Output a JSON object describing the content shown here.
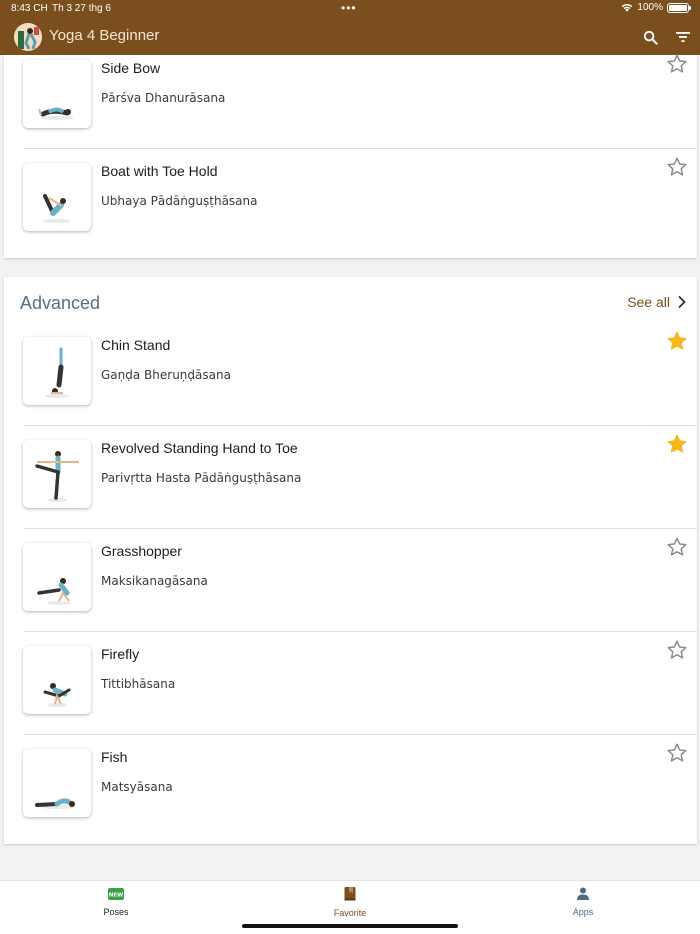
{
  "status": {
    "time": "8:43 CH",
    "date": "Th 3 27 thg 6",
    "battery": "100%"
  },
  "app": {
    "title": "Yoga 4 Beginner"
  },
  "top_section": {
    "poses": [
      {
        "name": "Side Bow",
        "sanskrit": "Pārśva Dhanurāsana",
        "favorite": false
      },
      {
        "name": "Boat with Toe Hold",
        "sanskrit": "Ubhaya Pādāṅguṣṭhāsana",
        "favorite": false
      }
    ]
  },
  "advanced": {
    "title": "Advanced",
    "see_all": "See all",
    "poses": [
      {
        "name": "Chin Stand",
        "sanskrit": "Gaṇḍa Bheruṇḍāsana",
        "favorite": true
      },
      {
        "name": "Revolved Standing Hand to Toe",
        "sanskrit": "Parivṛtta Hasta Pādāṅguṣṭhāsana",
        "favorite": true
      },
      {
        "name": "Grasshopper",
        "sanskrit": "Maksikanagāsana",
        "favorite": false
      },
      {
        "name": "Firefly",
        "sanskrit": "Tittibhāsana",
        "favorite": false
      },
      {
        "name": "Fish",
        "sanskrit": "Matsyāsana",
        "favorite": false
      }
    ]
  },
  "tabs": {
    "poses": {
      "label": "Poses",
      "badge": "NEW"
    },
    "favorite": {
      "label": "Favorite"
    },
    "apps": {
      "label": "Apps"
    }
  },
  "colors": {
    "brand": "#7b4f1d",
    "section_title": "#566f81",
    "star_active": "#f6b81e",
    "star_inactive": "#8a8a8a",
    "tab_active": "#3aa24a"
  },
  "icons": {
    "search": "search-icon",
    "filter": "filter-icon",
    "chevron": "chevron-right-icon",
    "star": "star-icon"
  }
}
